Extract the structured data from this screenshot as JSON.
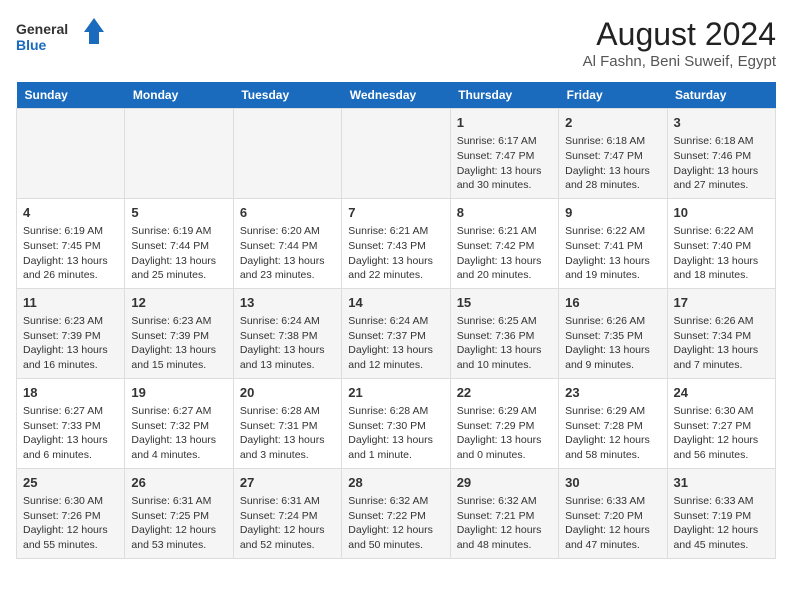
{
  "logo": {
    "line1": "General",
    "line2": "Blue"
  },
  "title": "August 2024",
  "subtitle": "Al Fashn, Beni Suweif, Egypt",
  "weekdays": [
    "Sunday",
    "Monday",
    "Tuesday",
    "Wednesday",
    "Thursday",
    "Friday",
    "Saturday"
  ],
  "weeks": [
    [
      {
        "day": "",
        "info": ""
      },
      {
        "day": "",
        "info": ""
      },
      {
        "day": "",
        "info": ""
      },
      {
        "day": "",
        "info": ""
      },
      {
        "day": "1",
        "info": "Sunrise: 6:17 AM\nSunset: 7:47 PM\nDaylight: 13 hours and 30 minutes."
      },
      {
        "day": "2",
        "info": "Sunrise: 6:18 AM\nSunset: 7:47 PM\nDaylight: 13 hours and 28 minutes."
      },
      {
        "day": "3",
        "info": "Sunrise: 6:18 AM\nSunset: 7:46 PM\nDaylight: 13 hours and 27 minutes."
      }
    ],
    [
      {
        "day": "4",
        "info": "Sunrise: 6:19 AM\nSunset: 7:45 PM\nDaylight: 13 hours and 26 minutes."
      },
      {
        "day": "5",
        "info": "Sunrise: 6:19 AM\nSunset: 7:44 PM\nDaylight: 13 hours and 25 minutes."
      },
      {
        "day": "6",
        "info": "Sunrise: 6:20 AM\nSunset: 7:44 PM\nDaylight: 13 hours and 23 minutes."
      },
      {
        "day": "7",
        "info": "Sunrise: 6:21 AM\nSunset: 7:43 PM\nDaylight: 13 hours and 22 minutes."
      },
      {
        "day": "8",
        "info": "Sunrise: 6:21 AM\nSunset: 7:42 PM\nDaylight: 13 hours and 20 minutes."
      },
      {
        "day": "9",
        "info": "Sunrise: 6:22 AM\nSunset: 7:41 PM\nDaylight: 13 hours and 19 minutes."
      },
      {
        "day": "10",
        "info": "Sunrise: 6:22 AM\nSunset: 7:40 PM\nDaylight: 13 hours and 18 minutes."
      }
    ],
    [
      {
        "day": "11",
        "info": "Sunrise: 6:23 AM\nSunset: 7:39 PM\nDaylight: 13 hours and 16 minutes."
      },
      {
        "day": "12",
        "info": "Sunrise: 6:23 AM\nSunset: 7:39 PM\nDaylight: 13 hours and 15 minutes."
      },
      {
        "day": "13",
        "info": "Sunrise: 6:24 AM\nSunset: 7:38 PM\nDaylight: 13 hours and 13 minutes."
      },
      {
        "day": "14",
        "info": "Sunrise: 6:24 AM\nSunset: 7:37 PM\nDaylight: 13 hours and 12 minutes."
      },
      {
        "day": "15",
        "info": "Sunrise: 6:25 AM\nSunset: 7:36 PM\nDaylight: 13 hours and 10 minutes."
      },
      {
        "day": "16",
        "info": "Sunrise: 6:26 AM\nSunset: 7:35 PM\nDaylight: 13 hours and 9 minutes."
      },
      {
        "day": "17",
        "info": "Sunrise: 6:26 AM\nSunset: 7:34 PM\nDaylight: 13 hours and 7 minutes."
      }
    ],
    [
      {
        "day": "18",
        "info": "Sunrise: 6:27 AM\nSunset: 7:33 PM\nDaylight: 13 hours and 6 minutes."
      },
      {
        "day": "19",
        "info": "Sunrise: 6:27 AM\nSunset: 7:32 PM\nDaylight: 13 hours and 4 minutes."
      },
      {
        "day": "20",
        "info": "Sunrise: 6:28 AM\nSunset: 7:31 PM\nDaylight: 13 hours and 3 minutes."
      },
      {
        "day": "21",
        "info": "Sunrise: 6:28 AM\nSunset: 7:30 PM\nDaylight: 13 hours and 1 minute."
      },
      {
        "day": "22",
        "info": "Sunrise: 6:29 AM\nSunset: 7:29 PM\nDaylight: 13 hours and 0 minutes."
      },
      {
        "day": "23",
        "info": "Sunrise: 6:29 AM\nSunset: 7:28 PM\nDaylight: 12 hours and 58 minutes."
      },
      {
        "day": "24",
        "info": "Sunrise: 6:30 AM\nSunset: 7:27 PM\nDaylight: 12 hours and 56 minutes."
      }
    ],
    [
      {
        "day": "25",
        "info": "Sunrise: 6:30 AM\nSunset: 7:26 PM\nDaylight: 12 hours and 55 minutes."
      },
      {
        "day": "26",
        "info": "Sunrise: 6:31 AM\nSunset: 7:25 PM\nDaylight: 12 hours and 53 minutes."
      },
      {
        "day": "27",
        "info": "Sunrise: 6:31 AM\nSunset: 7:24 PM\nDaylight: 12 hours and 52 minutes."
      },
      {
        "day": "28",
        "info": "Sunrise: 6:32 AM\nSunset: 7:22 PM\nDaylight: 12 hours and 50 minutes."
      },
      {
        "day": "29",
        "info": "Sunrise: 6:32 AM\nSunset: 7:21 PM\nDaylight: 12 hours and 48 minutes."
      },
      {
        "day": "30",
        "info": "Sunrise: 6:33 AM\nSunset: 7:20 PM\nDaylight: 12 hours and 47 minutes."
      },
      {
        "day": "31",
        "info": "Sunrise: 6:33 AM\nSunset: 7:19 PM\nDaylight: 12 hours and 45 minutes."
      }
    ]
  ]
}
